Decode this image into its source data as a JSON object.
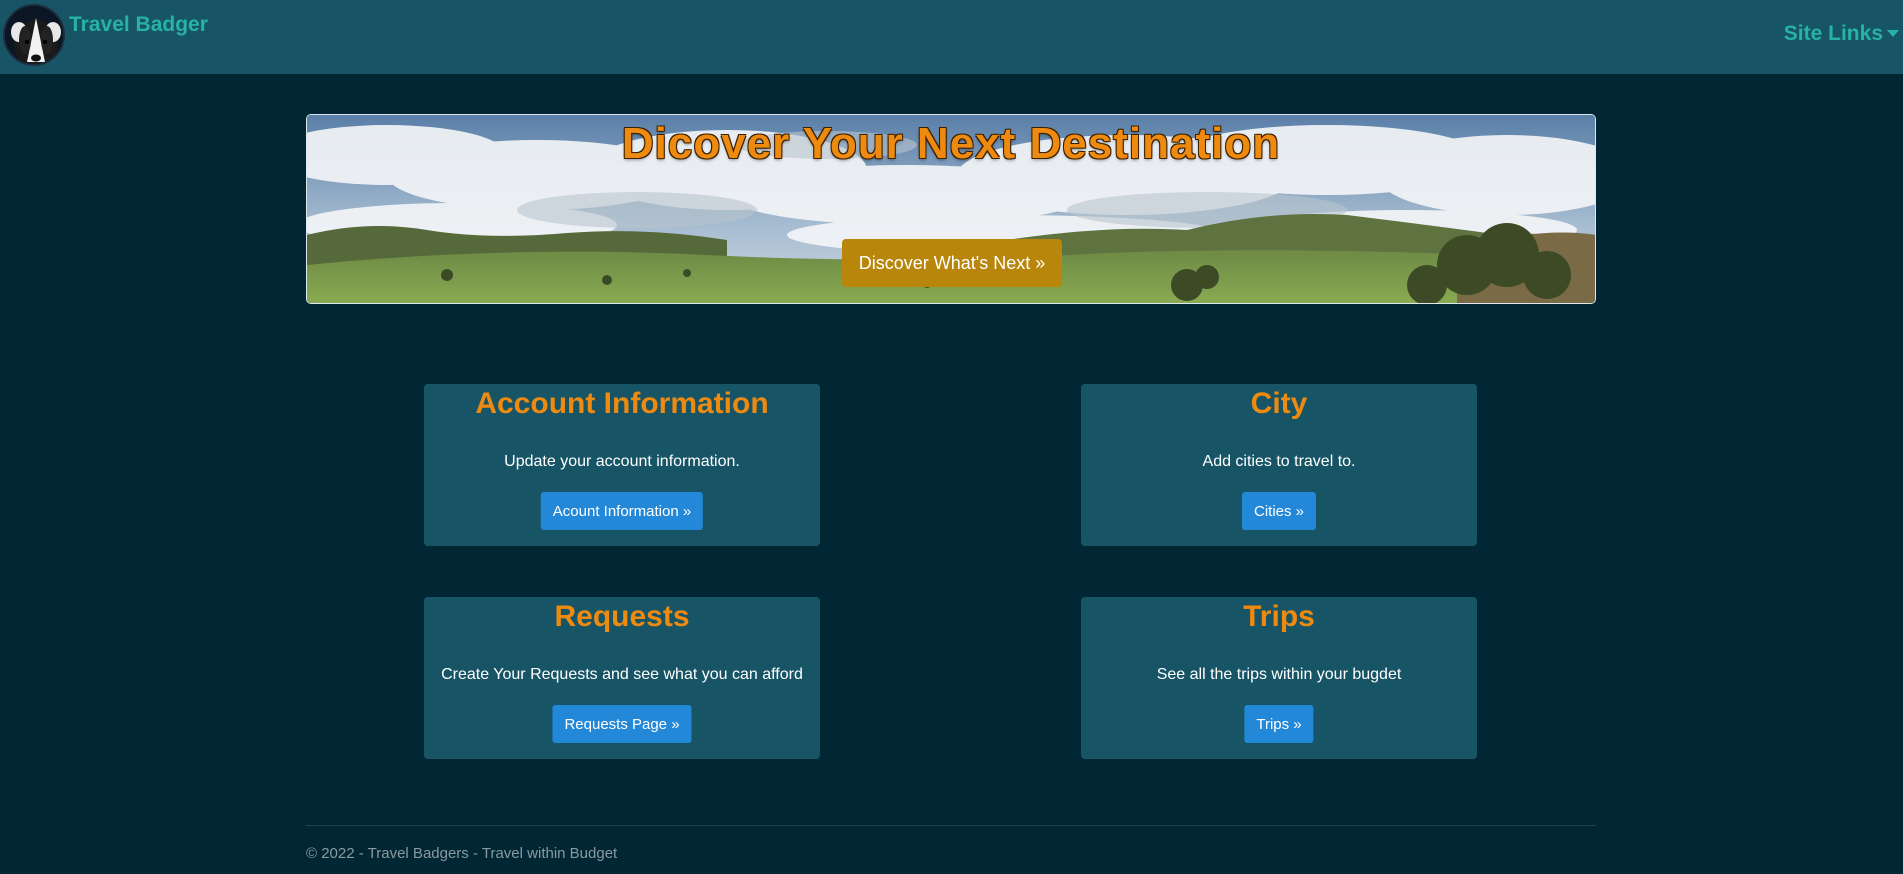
{
  "navbar": {
    "brand": "Travel Badger",
    "site_links": "Site Links"
  },
  "hero": {
    "title": "Dicover Your Next Destination",
    "button": "Discover What's Next »"
  },
  "cards": [
    {
      "title": "Account Information",
      "description": "Update your account information.",
      "button": "Acount Information »"
    },
    {
      "title": "City",
      "description": "Add cities to travel to.",
      "button": "Cities »"
    },
    {
      "title": "Requests",
      "description": "Create Your Requests and see what you can afford",
      "button": "Requests Page »"
    },
    {
      "title": "Trips",
      "description": "See all the trips within your bugdet",
      "button": "Trips »"
    }
  ],
  "footer": {
    "text": "© 2022 - Travel Badgers - Travel within Budget"
  },
  "colors": {
    "navbar_bg": "#175566",
    "page_bg": "#002733",
    "brand_teal": "#27b3a3",
    "heading_orange": "#ee8a10",
    "hero_button": "#b8860b",
    "card_button": "#2488d8"
  }
}
